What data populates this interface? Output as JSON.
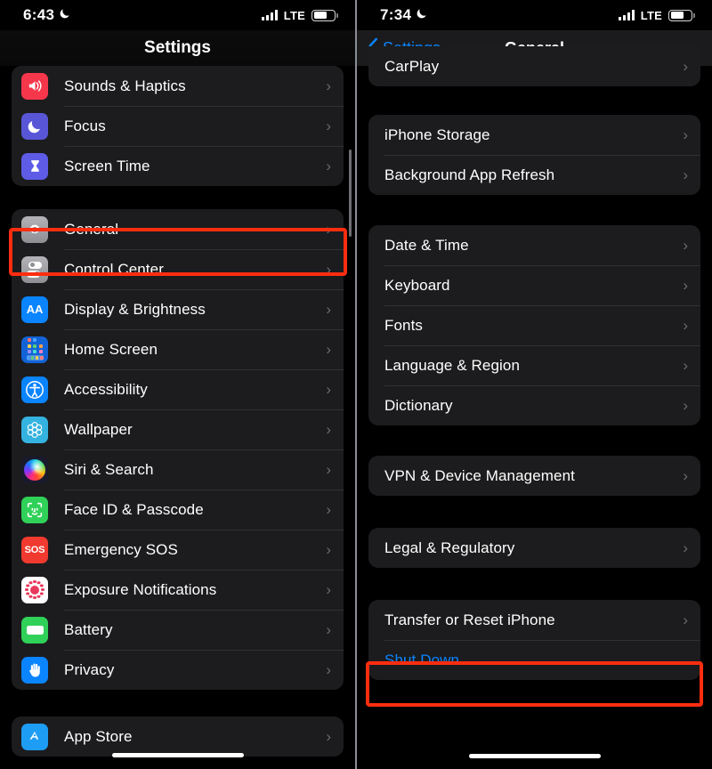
{
  "left_panel": {
    "status_bar": {
      "time": "6:43",
      "moon_icon": "crescent-moon-icon",
      "signal_icon": "cellular-bars-icon",
      "carrier": "LTE",
      "battery_icon": "battery-icon"
    },
    "nav": {
      "title": "Settings"
    },
    "groups": [
      {
        "rows": [
          {
            "label": "Sounds & Haptics",
            "icon": "speaker-icon",
            "icon_class": "ic-sounds",
            "chevron": "›"
          },
          {
            "label": "Focus",
            "icon": "moon-icon",
            "icon_class": "ic-focus",
            "chevron": "›"
          },
          {
            "label": "Screen Time",
            "icon": "hourglass-icon",
            "icon_class": "ic-screen",
            "chevron": "›"
          }
        ]
      },
      {
        "rows": [
          {
            "label": "General",
            "icon": "gear-icon",
            "icon_class": "ic-general",
            "chevron": "›"
          },
          {
            "label": "Control Center",
            "icon": "toggles-icon",
            "icon_class": "ic-control",
            "chevron": "›"
          },
          {
            "label": "Display & Brightness",
            "icon": "aa-icon",
            "icon_class": "ic-display",
            "icon_text": "AA",
            "chevron": "›"
          },
          {
            "label": "Home Screen",
            "icon": "app-grid-icon",
            "icon_class": "ic-home",
            "chevron": "›"
          },
          {
            "label": "Accessibility",
            "icon": "accessibility-person-icon",
            "icon_class": "ic-access",
            "chevron": "›"
          },
          {
            "label": "Wallpaper",
            "icon": "flower-icon",
            "icon_class": "ic-wall",
            "chevron": "›"
          },
          {
            "label": "Siri & Search",
            "icon": "siri-orb-icon",
            "icon_class": "ic-siri",
            "chevron": "›"
          },
          {
            "label": "Face ID & Passcode",
            "icon": "face-id-icon",
            "icon_class": "ic-faceid",
            "chevron": "›"
          },
          {
            "label": "Emergency SOS",
            "icon": "sos-icon",
            "icon_class": "ic-sos",
            "icon_text": "SOS",
            "chevron": "›"
          },
          {
            "label": "Exposure Notifications",
            "icon": "exposure-dots-icon",
            "icon_class": "ic-exposure",
            "chevron": "›"
          },
          {
            "label": "Battery",
            "icon": "battery-icon",
            "icon_class": "ic-battery",
            "chevron": "›"
          },
          {
            "label": "Privacy",
            "icon": "hand-icon",
            "icon_class": "ic-privacy",
            "chevron": "›"
          }
        ]
      },
      {
        "rows": [
          {
            "label": "App Store",
            "icon": "app-store-icon",
            "icon_class": "ic-appstore",
            "chevron": "›"
          }
        ]
      }
    ],
    "highlight": {
      "target": "General",
      "color": "#ff2d0f"
    },
    "scrollbar_visible": true
  },
  "right_panel": {
    "status_bar": {
      "time": "7:34",
      "moon_icon": "crescent-moon-icon",
      "signal_icon": "cellular-bars-icon",
      "carrier": "LTE",
      "battery_icon": "battery-icon"
    },
    "nav": {
      "back_label": "Settings",
      "back_icon": "chevron-left-icon",
      "title": "General",
      "accent_color": "#0a84ff"
    },
    "groups": [
      {
        "partial_top": true,
        "rows": [
          {
            "label": "CarPlay",
            "chevron": "›"
          }
        ]
      },
      {
        "rows": [
          {
            "label": "iPhone Storage",
            "chevron": "›"
          },
          {
            "label": "Background App Refresh",
            "chevron": "›"
          }
        ]
      },
      {
        "rows": [
          {
            "label": "Date & Time",
            "chevron": "›"
          },
          {
            "label": "Keyboard",
            "chevron": "›"
          },
          {
            "label": "Fonts",
            "chevron": "›"
          },
          {
            "label": "Language & Region",
            "chevron": "›"
          },
          {
            "label": "Dictionary",
            "chevron": "›"
          }
        ]
      },
      {
        "rows": [
          {
            "label": "VPN & Device Management",
            "chevron": "›"
          }
        ]
      },
      {
        "rows": [
          {
            "label": "Legal & Regulatory",
            "chevron": "›"
          }
        ]
      },
      {
        "rows": [
          {
            "label": "Transfer or Reset iPhone",
            "chevron": "›"
          },
          {
            "label": "Shut Down",
            "accent": true
          }
        ]
      }
    ],
    "highlight": {
      "target": "Shut Down",
      "color": "#ff2d0f"
    }
  }
}
